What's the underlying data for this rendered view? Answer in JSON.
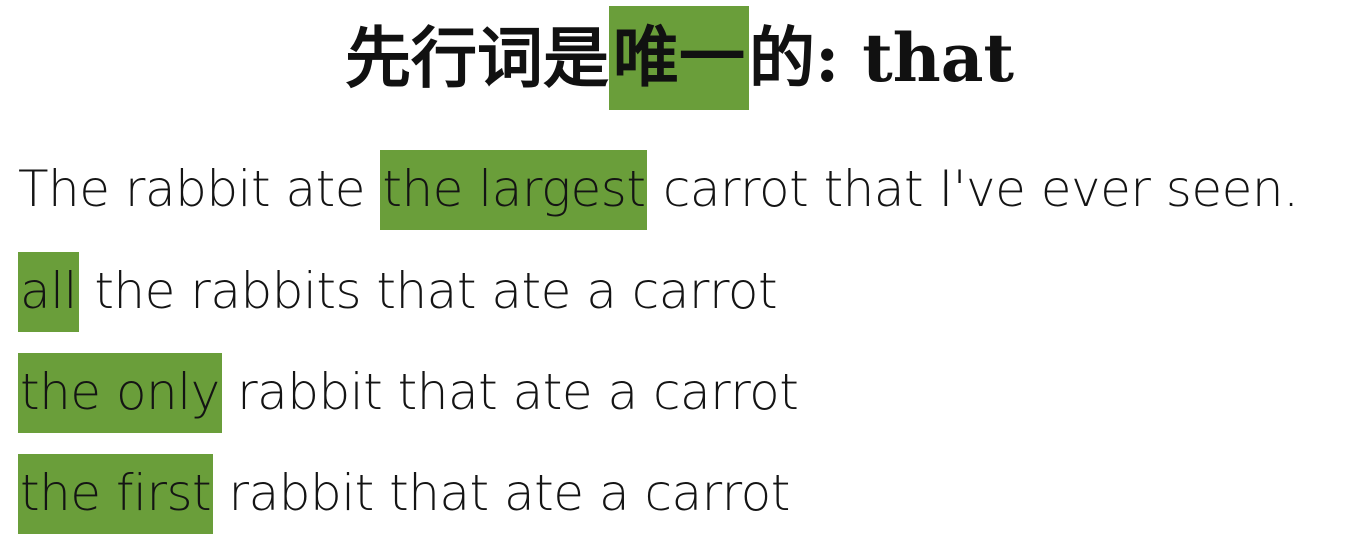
{
  "title": {
    "before": "先行词是",
    "highlight": "唯一",
    "after": "的: that"
  },
  "highlight_color": "#6a9e3a",
  "examples": [
    {
      "highlight": "",
      "before": "The rabbit ate ",
      "mid_highlight": "the largest",
      "after": " carrot that I've ever seen."
    },
    {
      "highlight": "all",
      "after": " the rabbits that ate a carrot"
    },
    {
      "highlight": "the only",
      "after": " rabbit that ate a carrot"
    },
    {
      "highlight": "the first",
      "after": " rabbit that ate a carrot"
    }
  ]
}
